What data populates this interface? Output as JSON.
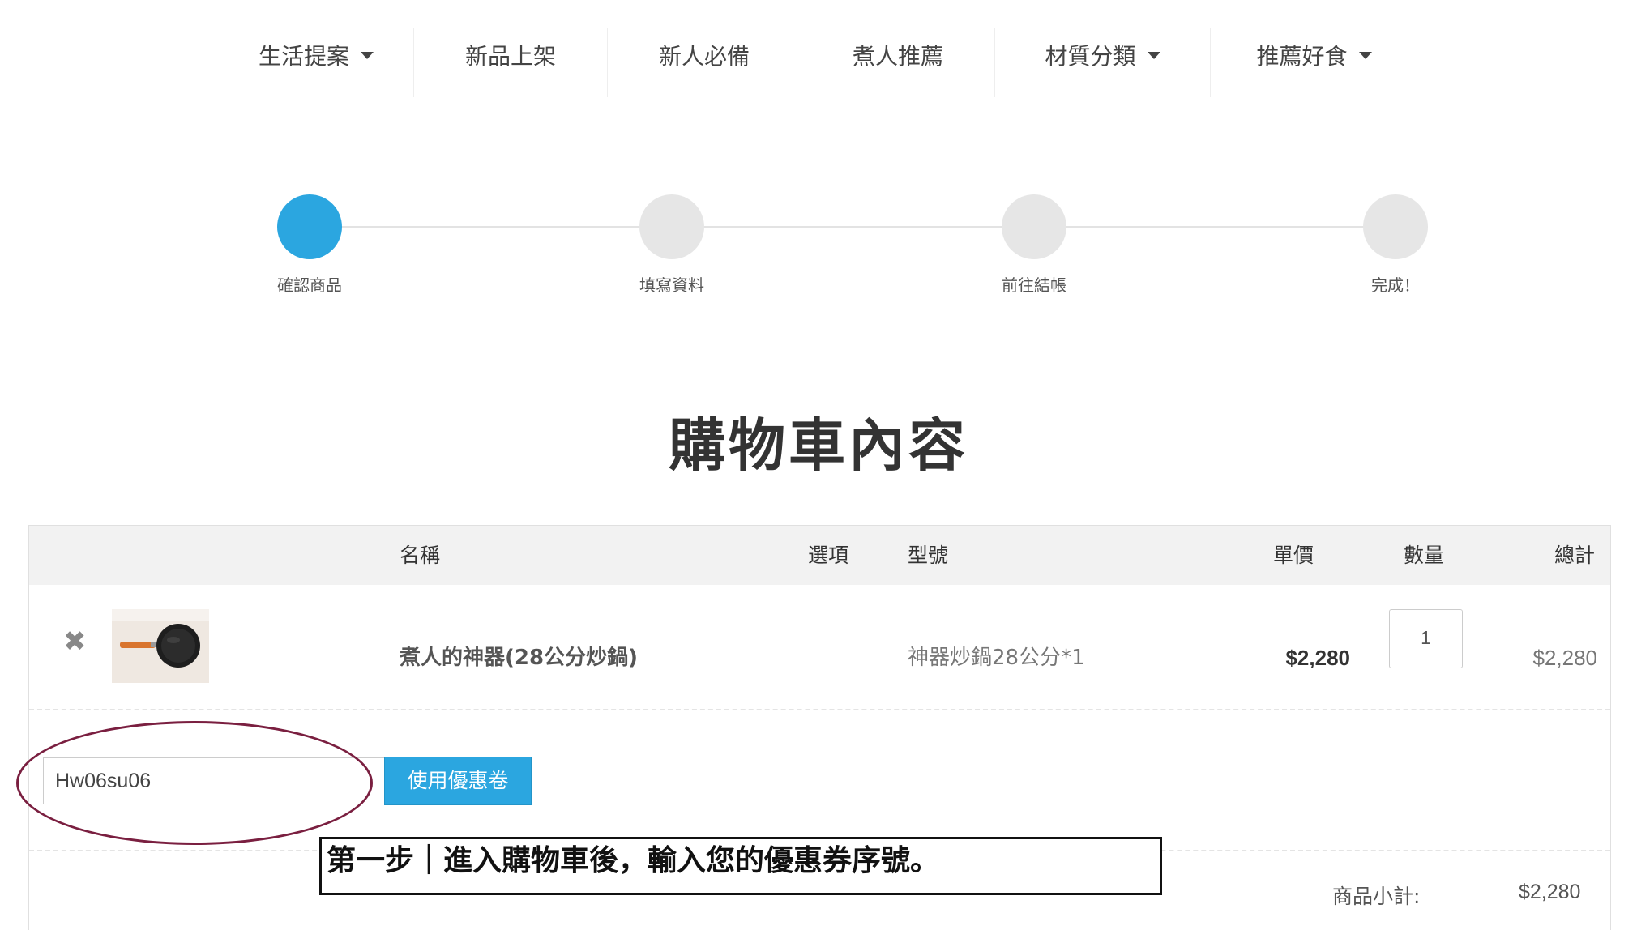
{
  "nav": {
    "items": [
      {
        "label": "生活提案",
        "dropdown": true
      },
      {
        "label": "新品上架",
        "dropdown": false
      },
      {
        "label": "新人必備",
        "dropdown": false
      },
      {
        "label": "煮人推薦",
        "dropdown": false
      },
      {
        "label": "材質分類",
        "dropdown": true
      },
      {
        "label": "推薦好食",
        "dropdown": true
      }
    ]
  },
  "steps": {
    "current": 1,
    "items": [
      {
        "label": "確認商品"
      },
      {
        "label": "填寫資料"
      },
      {
        "label": "前往結帳"
      },
      {
        "label": "完成！"
      }
    ]
  },
  "page_title": "購物車內容",
  "cart": {
    "headers": {
      "name": "名稱",
      "option": "選項",
      "model": "型號",
      "unit_price": "單價",
      "quantity": "數量",
      "total": "總計"
    },
    "items": [
      {
        "name": "煮人的神器(28公分炒鍋)",
        "option": "",
        "model": "神器炒鍋28公分*1",
        "unit_price": "$2,280",
        "quantity": "1",
        "total": "$2,280",
        "image": "frying-pan"
      }
    ],
    "remove_icon": "✖"
  },
  "coupon": {
    "value": "Hw06su06",
    "button_label": "使用優惠卷"
  },
  "summary": {
    "subtotal_label": "商品小計:",
    "subtotal_value": "$2,280"
  },
  "annotation": {
    "instruction": "第一步｜進入購物車後，輸入您的優惠券序號。"
  },
  "colors": {
    "accent": "#2ba6e0",
    "step_inactive": "#e6e6e6",
    "highlight": "#7a1f40"
  }
}
